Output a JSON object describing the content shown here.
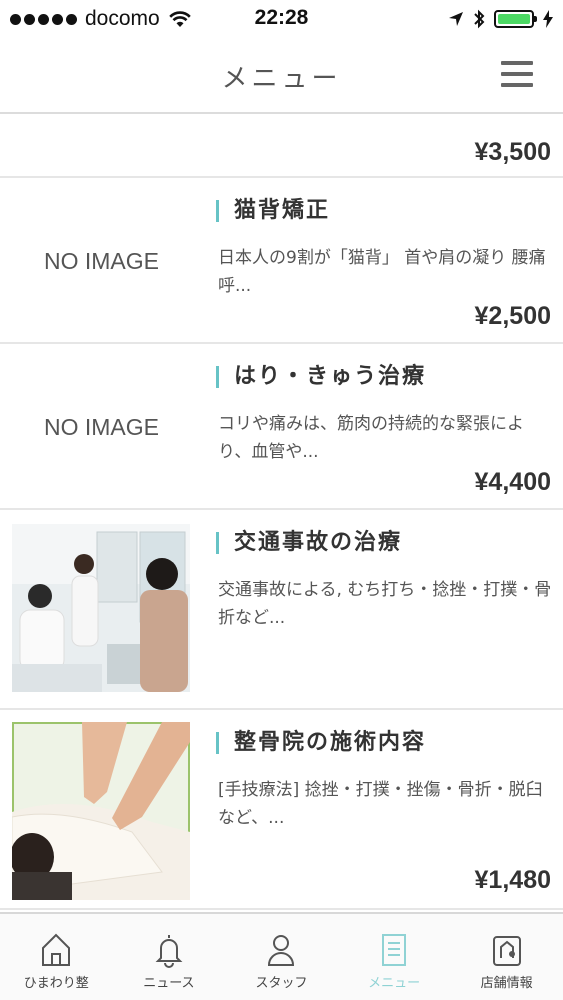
{
  "status_bar": {
    "carrier": "docomo",
    "time": "22:28",
    "battery_level": 1.0,
    "icons": [
      "signal-dots-icon",
      "wifi-icon",
      "location-arrow-icon",
      "bluetooth-icon",
      "battery-icon",
      "charging-icon"
    ]
  },
  "header": {
    "title": "メニュー",
    "menu_icon": "hamburger-icon"
  },
  "menu_items": [
    {
      "price": "¥3,500"
    },
    {
      "title": "猫背矯正",
      "description": "日本人の9割が「猫背」 首や肩の凝り 腰痛 呼...",
      "image": "NO IMAGE",
      "price": "¥2,500"
    },
    {
      "title": "はり・きゅう治療",
      "description": "コリや痛みは、筋肉の持続的な緊張により、血管や...",
      "image": "NO IMAGE",
      "price": "¥4,400"
    },
    {
      "title": "交通事故の治療",
      "description": "交通事故による, むち打ち・捻挫・打撲・骨折など...",
      "image": "photo-clinic-consultation"
    },
    {
      "title": "整骨院の施術内容",
      "description": "[手技療法] 捻挫・打撲・挫傷・骨折・脱臼など、...",
      "image": "photo-back-massage",
      "price": "¥1,480"
    }
  ],
  "tabbar": {
    "active": "menu",
    "active_color": "#8fd2d4",
    "accent_color": "#67c3c6",
    "tabs": [
      {
        "label": "ひまわり整",
        "icon": "home-icon"
      },
      {
        "label": "ニュース",
        "icon": "bell-icon"
      },
      {
        "label": "スタッフ",
        "icon": "person-icon"
      },
      {
        "label": "メニュー",
        "icon": "document-icon"
      },
      {
        "label": "店舗情報",
        "icon": "shop-info-icon"
      }
    ]
  }
}
